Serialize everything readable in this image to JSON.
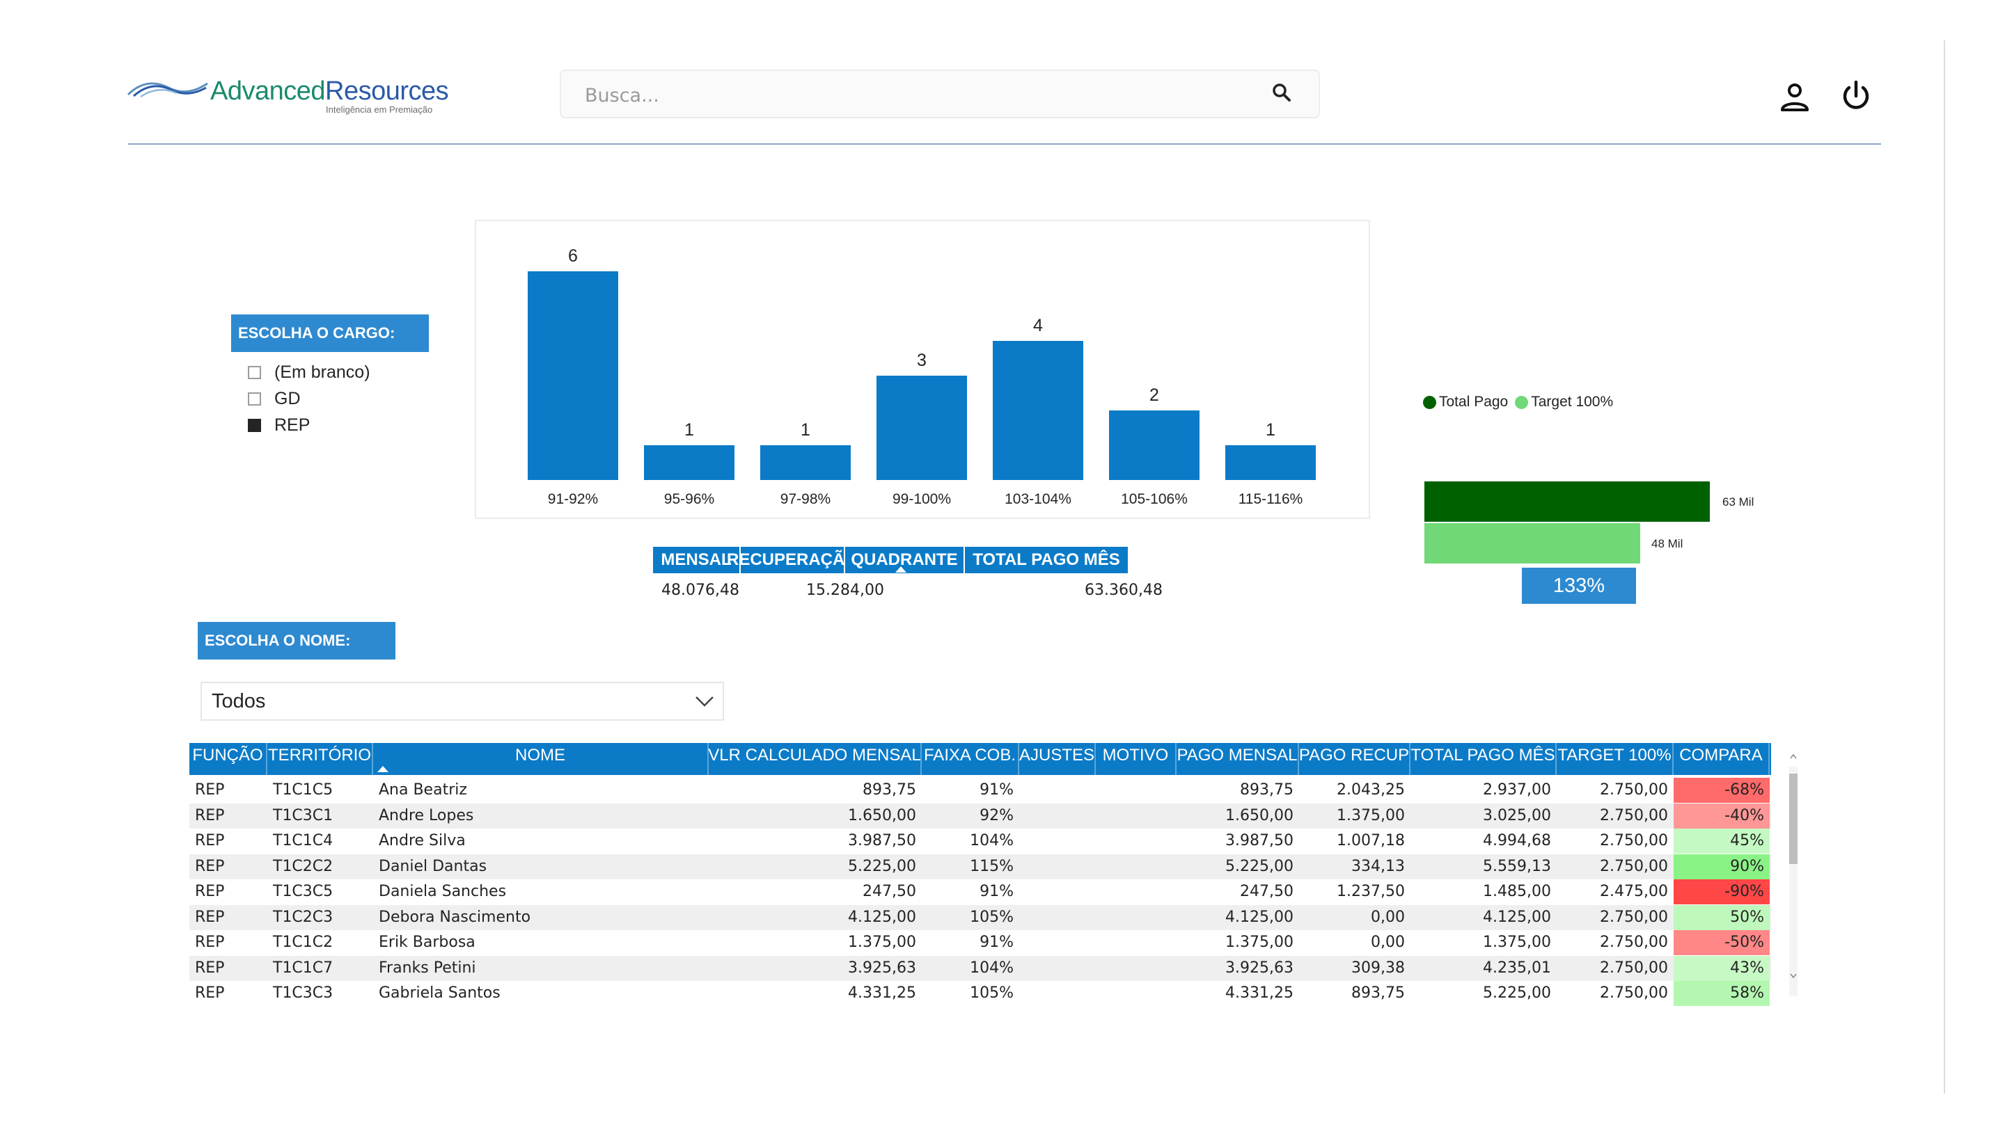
{
  "header": {
    "logo_name_a": "Advanced",
    "logo_name_b": "Resources",
    "logo_tagline": "Inteligência em Premiação",
    "search_placeholder": "Busca...",
    "icons": [
      "search-icon",
      "user-icon",
      "power-icon"
    ]
  },
  "cargo_slicer": {
    "title": "ESCOLHA O CARGO:",
    "options": [
      {
        "label": "(Em branco)",
        "checked": false
      },
      {
        "label": "GD",
        "checked": false
      },
      {
        "label": "REP",
        "checked": true
      }
    ]
  },
  "chart_data": {
    "type": "bar",
    "categories": [
      "91-92%",
      "95-96%",
      "97-98%",
      "99-100%",
      "103-104%",
      "105-106%",
      "115-116%"
    ],
    "values": [
      6,
      1,
      1,
      3,
      4,
      2,
      1
    ],
    "title": "",
    "xlabel": "",
    "ylabel": "",
    "ylim": [
      0,
      6
    ],
    "grid": false,
    "color": "#0b7bc8"
  },
  "summary": {
    "headers": [
      "MENSAL",
      "RECUPERAÇÃO",
      "QUADRANTE",
      "TOTAL PAGO MÊS"
    ],
    "values": [
      "48.076,48",
      "15.284,00",
      "",
      "63.360,48"
    ]
  },
  "comparison": {
    "legend": [
      "Total Pago",
      "Target 100%"
    ],
    "legend_colors": [
      "#006100",
      "#70d877"
    ],
    "total_label": "63 Mil",
    "target_label": "48 Mil",
    "total_value": 63360.48,
    "target_value": 48000,
    "percent": "133%"
  },
  "nome_slicer": {
    "title": "ESCOLHA O NOME:",
    "selected": "Todos"
  },
  "table": {
    "columns": [
      "FUNÇÃO",
      "TERRITÓRIO",
      "NOME",
      "VLR CALCULADO MENSAL",
      "FAIXA COB.",
      "AJUSTES",
      "MOTIVO",
      "PAGO MENSAL",
      "PAGO RECUP",
      "TOTAL PAGO MÊS",
      "TARGET 100%",
      "COMPARA"
    ],
    "rows": [
      [
        "REP",
        "T1C1C5",
        "Ana Beatriz",
        "893,75",
        "91%",
        "",
        "",
        "893,75",
        "2.043,25",
        "2.937,00",
        "2.750,00",
        "-68%"
      ],
      [
        "REP",
        "T1C3C1",
        "Andre Lopes",
        "1.650,00",
        "92%",
        "",
        "",
        "1.650,00",
        "1.375,00",
        "3.025,00",
        "2.750,00",
        "-40%"
      ],
      [
        "REP",
        "T1C1C4",
        "Andre Silva",
        "3.987,50",
        "104%",
        "",
        "",
        "3.987,50",
        "1.007,18",
        "4.994,68",
        "2.750,00",
        "45%"
      ],
      [
        "REP",
        "T1C2C2",
        "Daniel Dantas",
        "5.225,00",
        "115%",
        "",
        "",
        "5.225,00",
        "334,13",
        "5.559,13",
        "2.750,00",
        "90%"
      ],
      [
        "REP",
        "T1C3C5",
        "Daniela Sanches",
        "247,50",
        "91%",
        "",
        "",
        "247,50",
        "1.237,50",
        "1.485,00",
        "2.475,00",
        "-90%"
      ],
      [
        "REP",
        "T1C2C3",
        "Debora Nascimento",
        "4.125,00",
        "105%",
        "",
        "",
        "4.125,00",
        "0,00",
        "4.125,00",
        "2.750,00",
        "50%"
      ],
      [
        "REP",
        "T1C1C2",
        "Erik Barbosa",
        "1.375,00",
        "91%",
        "",
        "",
        "1.375,00",
        "0,00",
        "1.375,00",
        "2.750,00",
        "-50%"
      ],
      [
        "REP",
        "T1C1C7",
        "Franks Petini",
        "3.925,63",
        "104%",
        "",
        "",
        "3.925,63",
        "309,38",
        "4.235,01",
        "2.750,00",
        "43%"
      ],
      [
        "REP",
        "T1C3C3",
        "Gabriela Santos",
        "4.331,25",
        "105%",
        "",
        "",
        "4.331,25",
        "893,75",
        "5.225,00",
        "2.750,00",
        "58%"
      ]
    ]
  }
}
